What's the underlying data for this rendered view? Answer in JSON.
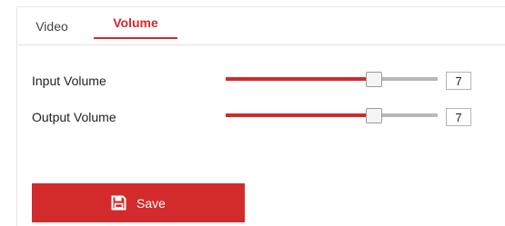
{
  "tabs": [
    {
      "label": "Video",
      "active": false
    },
    {
      "label": "Volume",
      "active": true
    }
  ],
  "settings": [
    {
      "label": "Input Volume",
      "value": "7",
      "level_fraction": 0.7
    },
    {
      "label": "Output Volume",
      "value": "7",
      "level_fraction": 0.7
    }
  ],
  "save_button": {
    "label": "Save",
    "icon": "floppy-disk-icon"
  },
  "colors": {
    "accent": "#d22a2a",
    "track": "#b8b8b8"
  }
}
